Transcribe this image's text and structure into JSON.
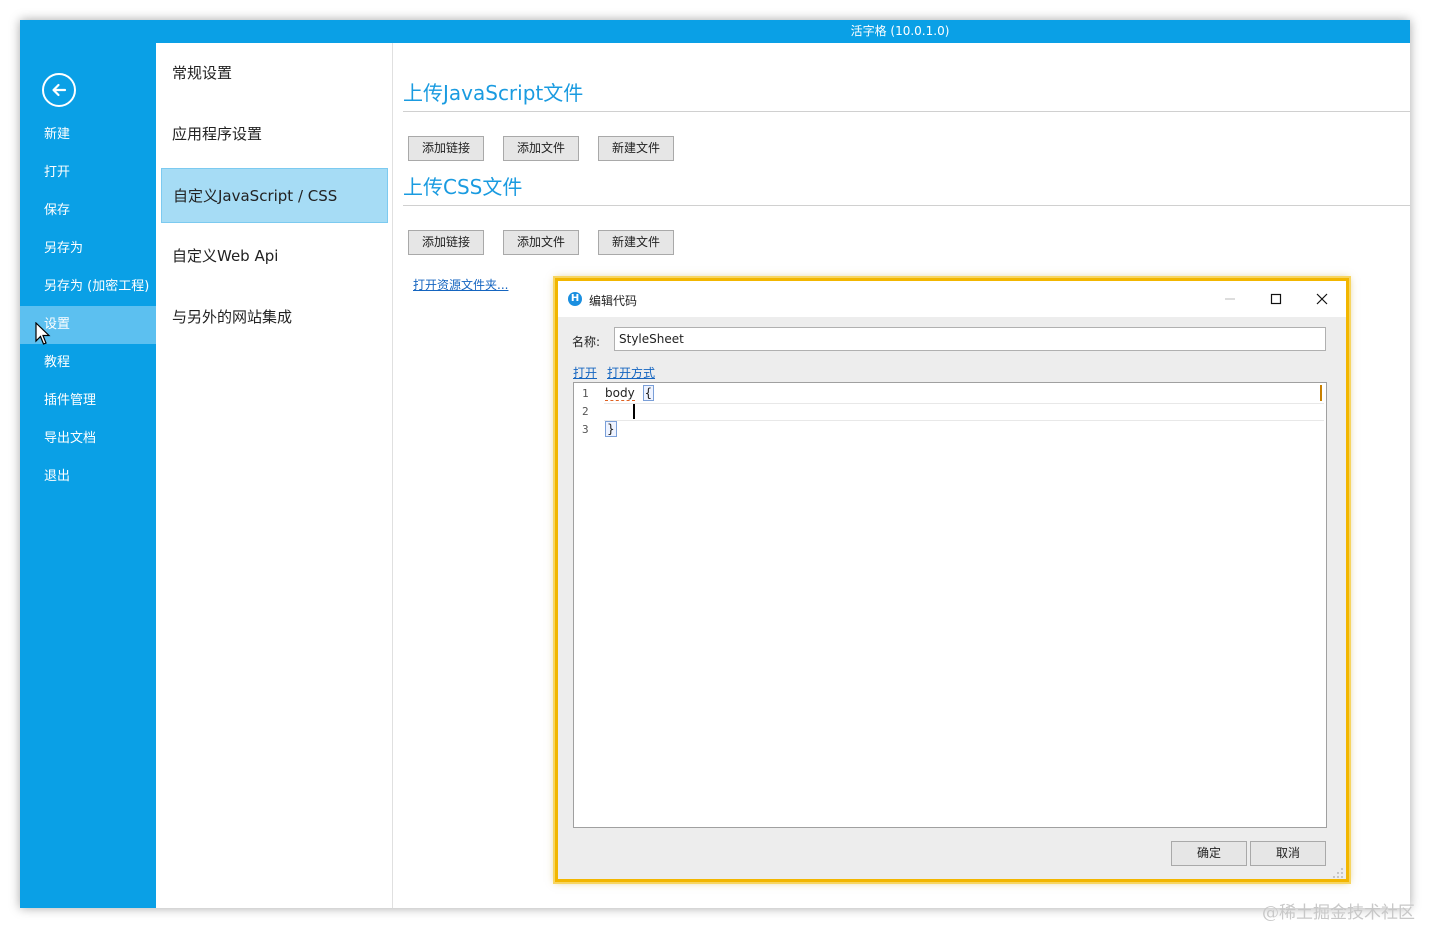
{
  "window": {
    "title": "活字格 (10.0.1.0)"
  },
  "sidebar": {
    "items": [
      {
        "label": "新建"
      },
      {
        "label": "打开"
      },
      {
        "label": "保存"
      },
      {
        "label": "另存为"
      },
      {
        "label": "另存为 (加密工程)"
      },
      {
        "label": "设置"
      },
      {
        "label": "教程"
      },
      {
        "label": "插件管理"
      },
      {
        "label": "导出文档"
      },
      {
        "label": "退出"
      }
    ]
  },
  "settings_nav": {
    "items": [
      {
        "label": "常规设置"
      },
      {
        "label": "应用程序设置"
      },
      {
        "label": "自定义JavaScript / CSS"
      },
      {
        "label": "自定义Web Api"
      },
      {
        "label": "与另外的网站集成"
      }
    ]
  },
  "main": {
    "js_section": {
      "title": "上传JavaScript文件",
      "add_link": "添加链接",
      "add_file": "添加文件",
      "new_file": "新建文件"
    },
    "css_section": {
      "title": "上传CSS文件",
      "add_link": "添加链接",
      "add_file": "添加文件",
      "new_file": "新建文件"
    },
    "open_folder_link": "打开资源文件夹..."
  },
  "dialog": {
    "title": "编辑代码",
    "icon_letter": "H",
    "name_label": "名称:",
    "name_value": "StyleSheet",
    "open_link": "打开",
    "open_with_link": "打开方式",
    "code_lines": [
      {
        "no": "1",
        "text": "body",
        "brace": "{"
      },
      {
        "no": "2",
        "text": "",
        "brace": ""
      },
      {
        "no": "3",
        "text": "",
        "brace": "}"
      }
    ],
    "ok_label": "确定",
    "cancel_label": "取消"
  },
  "watermark": "@稀土掘金技术社区",
  "colors": {
    "accent": "#0aa0e6",
    "active_item": "#a6dcf5",
    "dialog_border": "#f2b600",
    "link": "#1565c0"
  }
}
